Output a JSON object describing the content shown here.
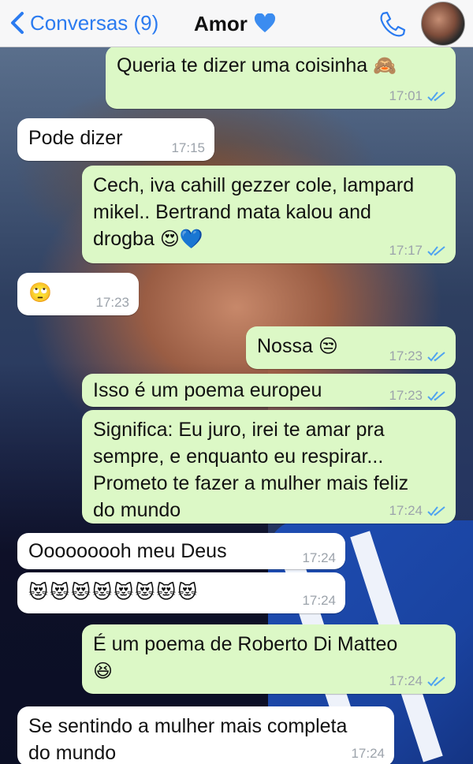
{
  "header": {
    "back_label": "Conversas (9)",
    "contact_name": "Amor",
    "heart_color": "#3b8cf0",
    "accent": "#2b7bf0"
  },
  "messages": [
    {
      "dir": "out",
      "text": "Queria te dizer uma coisinha",
      "emoji": "🙈",
      "time": "17:01"
    },
    {
      "dir": "in",
      "text": "Pode dizer",
      "emoji": "",
      "time": "17:15"
    },
    {
      "dir": "out",
      "text": "Cech, iva cahill gezzer cole, lampard\nmikel.. Bertrand mata kalou and\ndrogba",
      "emoji": "😍💙",
      "time": "17:17"
    },
    {
      "dir": "in",
      "text": "",
      "emoji": "🙄",
      "time": "17:23"
    },
    {
      "dir": "out",
      "text": "Nossa",
      "emoji": "😒",
      "time": "17:23"
    },
    {
      "dir": "out",
      "text": "Isso é um poema europeu",
      "emoji": "",
      "time": "17:23"
    },
    {
      "dir": "out",
      "text": "Significa: Eu juro, irei te amar pra\nsempre, e enquanto eu respirar...\nPrometo te fazer a mulher mais feliz\ndo mundo",
      "emoji": "",
      "time": "17:24"
    },
    {
      "dir": "in",
      "text": "Ooooooooh meu Deus",
      "emoji": "",
      "time": "17:24"
    },
    {
      "dir": "in",
      "text": "",
      "emoji": "😻😻😻😻😻😻😻😻",
      "time": "17:24"
    },
    {
      "dir": "out",
      "text": "É um poema de Roberto Di Matteo",
      "emoji": "😆",
      "time": "17:24"
    },
    {
      "dir": "in",
      "text": "Se sentindo a mulher mais completa\ndo mundo",
      "emoji": "",
      "time": "17:24"
    }
  ],
  "icons": {
    "back": "chevron-left-icon",
    "heart": "blue-heart-icon",
    "call": "phone-icon",
    "read": "double-check-icon"
  },
  "colors": {
    "outgoing_bubble": "#dcf8c6",
    "incoming_bubble": "#ffffff",
    "read_check": "#4fa3f0"
  }
}
